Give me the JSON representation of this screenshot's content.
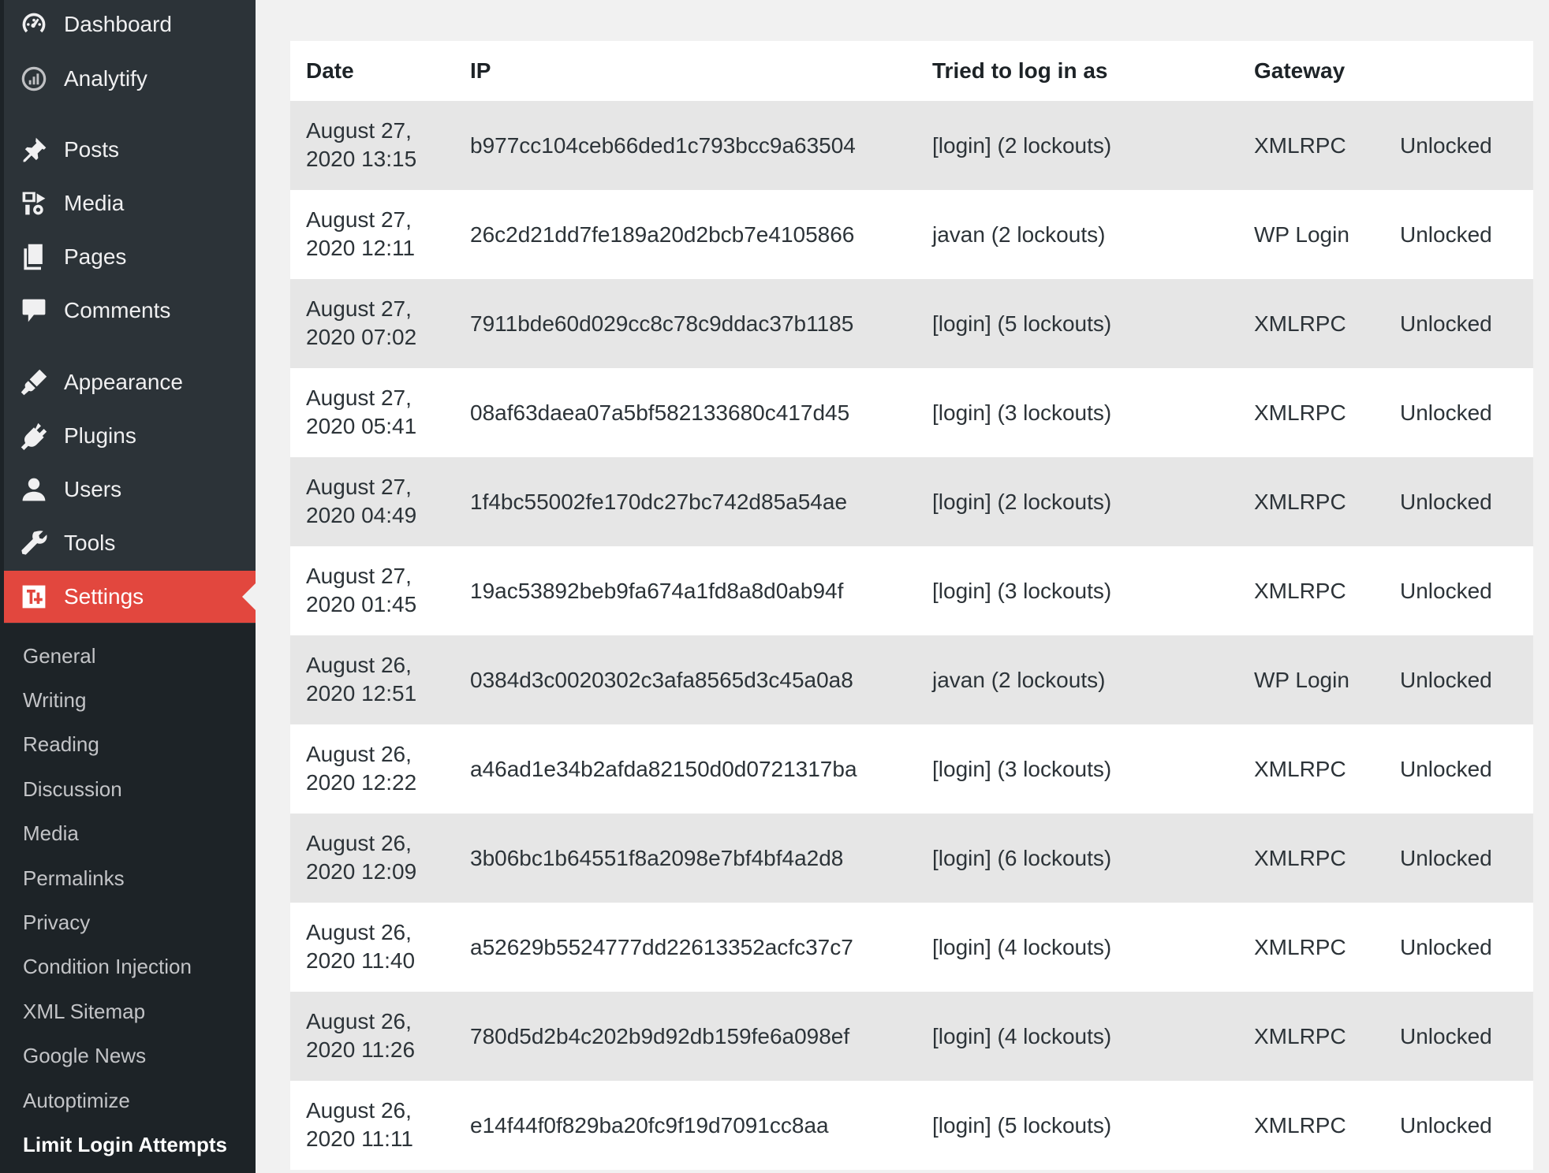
{
  "sidebar": {
    "menu": [
      {
        "label": "Dashboard",
        "icon": "dashboard-icon"
      },
      {
        "label": "Analytify",
        "icon": "analytify-icon"
      },
      {
        "label": "Posts",
        "icon": "pin-icon"
      },
      {
        "label": "Media",
        "icon": "media-icon"
      },
      {
        "label": "Pages",
        "icon": "pages-icon"
      },
      {
        "label": "Comments",
        "icon": "comment-icon"
      },
      {
        "label": "Appearance",
        "icon": "paintbrush-icon"
      },
      {
        "label": "Plugins",
        "icon": "plugin-icon"
      },
      {
        "label": "Users",
        "icon": "user-icon"
      },
      {
        "label": "Tools",
        "icon": "wrench-icon"
      },
      {
        "label": "Settings",
        "icon": "settings-icon"
      }
    ],
    "submenu": [
      "General",
      "Writing",
      "Reading",
      "Discussion",
      "Media",
      "Permalinks",
      "Privacy",
      "Condition Injection",
      "XML Sitemap",
      "Google News",
      "Autoptimize",
      "Limit Login Attempts"
    ],
    "active_menu": "Settings",
    "current_submenu": "Limit Login Attempts",
    "accent_color": "#e2473e"
  },
  "table": {
    "headers": {
      "date": "Date",
      "ip": "IP",
      "user": "Tried to log in as",
      "gateway": "Gateway"
    },
    "rows": [
      {
        "date1": "August 27,",
        "date2": "2020 13:15",
        "ip": "b977cc104ceb66ded1c793bcc9a63504",
        "user": "[login] (2 lockouts)",
        "gateway": "XMLRPC",
        "status": "Unlocked"
      },
      {
        "date1": "August 27,",
        "date2": "2020 12:11",
        "ip": "26c2d21dd7fe189a20d2bcb7e4105866",
        "user": "javan (2 lockouts)",
        "gateway": "WP Login",
        "status": "Unlocked"
      },
      {
        "date1": "August 27,",
        "date2": "2020 07:02",
        "ip": "7911bde60d029cc8c78c9ddac37b1185",
        "user": "[login] (5 lockouts)",
        "gateway": "XMLRPC",
        "status": "Unlocked"
      },
      {
        "date1": "August 27,",
        "date2": "2020 05:41",
        "ip": "08af63daea07a5bf582133680c417d45",
        "user": "[login] (3 lockouts)",
        "gateway": "XMLRPC",
        "status": "Unlocked"
      },
      {
        "date1": "August 27,",
        "date2": "2020 04:49",
        "ip": "1f4bc55002fe170dc27bc742d85a54ae",
        "user": "[login] (2 lockouts)",
        "gateway": "XMLRPC",
        "status": "Unlocked"
      },
      {
        "date1": "August 27,",
        "date2": "2020 01:45",
        "ip": "19ac53892beb9fa674a1fd8a8d0ab94f",
        "user": "[login] (3 lockouts)",
        "gateway": "XMLRPC",
        "status": "Unlocked"
      },
      {
        "date1": "August 26,",
        "date2": "2020 12:51",
        "ip": "0384d3c0020302c3afa8565d3c45a0a8",
        "user": "javan (2 lockouts)",
        "gateway": "WP Login",
        "status": "Unlocked"
      },
      {
        "date1": "August 26,",
        "date2": "2020 12:22",
        "ip": "a46ad1e34b2afda82150d0d0721317ba",
        "user": "[login] (3 lockouts)",
        "gateway": "XMLRPC",
        "status": "Unlocked"
      },
      {
        "date1": "August 26,",
        "date2": "2020 12:09",
        "ip": "3b06bc1b64551f8a2098e7bf4bf4a2d8",
        "user": "[login] (6 lockouts)",
        "gateway": "XMLRPC",
        "status": "Unlocked"
      },
      {
        "date1": "August 26,",
        "date2": "2020 11:40",
        "ip": "a52629b5524777dd22613352acfc37c7",
        "user": "[login] (4 lockouts)",
        "gateway": "XMLRPC",
        "status": "Unlocked"
      },
      {
        "date1": "August 26,",
        "date2": "2020 11:26",
        "ip": "780d5d2b4c202b9d92db159fe6a098ef",
        "user": "[login] (4 lockouts)",
        "gateway": "XMLRPC",
        "status": "Unlocked"
      },
      {
        "date1": "August 26,",
        "date2": "2020 11:11",
        "ip": "e14f44f0f829ba20fc9f19d7091cc8aa",
        "user": "[login] (5 lockouts)",
        "gateway": "XMLRPC",
        "status": "Unlocked"
      }
    ]
  }
}
